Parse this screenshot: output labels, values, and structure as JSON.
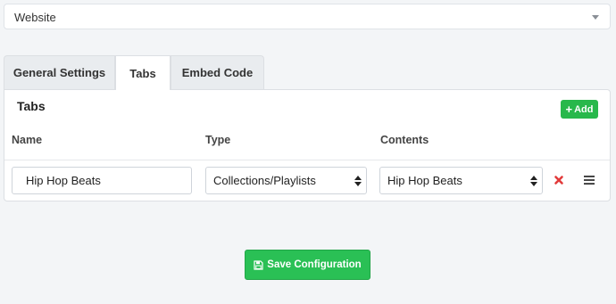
{
  "site_select": {
    "value": "Website"
  },
  "tabs": [
    {
      "label": "General Settings",
      "active": false
    },
    {
      "label": "Tabs",
      "active": true
    },
    {
      "label": "Embed Code",
      "active": false
    }
  ],
  "panel": {
    "title": "Tabs",
    "add_label": "Add",
    "columns": [
      "Name",
      "Type",
      "Contents"
    ],
    "rows": [
      {
        "name": "Hip Hop Beats",
        "type": "Collections/Playlists",
        "contents": "Hip Hop Beats"
      }
    ]
  },
  "save_label": "Save Configuration",
  "colors": {
    "accent_green": "#2ac055",
    "remove_red": "#e23b3b"
  },
  "icons": [
    "chevron-down-icon",
    "plus-icon",
    "select-arrows-icon",
    "remove-icon",
    "drag-handle-icon",
    "save-icon"
  ]
}
